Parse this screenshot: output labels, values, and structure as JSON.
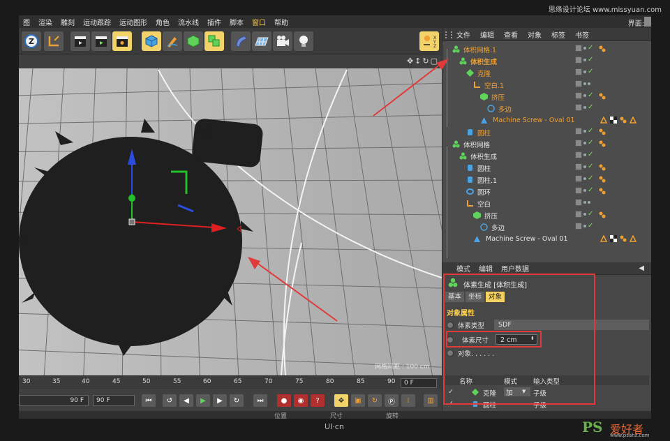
{
  "watermark_top": "思缘设计论坛 www.missyuan.com",
  "watermark_bottom": "UI·cn",
  "watermark_logo": {
    "ps": "PS",
    "cn": "爱好者",
    "url": "www.psahz.com"
  },
  "menubar": {
    "items": [
      "图",
      "渲染",
      "雕刻",
      "运动跟踪",
      "运动图形",
      "角色",
      "流水线",
      "插件",
      "脚本",
      "窗口",
      "帮助"
    ],
    "layout_label": "界面:"
  },
  "viewport": {
    "grid_spacing": "网格间距 : 100 cm"
  },
  "timeline": {
    "ticks": [
      "30",
      "35",
      "40",
      "45",
      "50",
      "55",
      "60",
      "65",
      "70",
      "75",
      "80",
      "85",
      "90"
    ],
    "current_frame": "0 F"
  },
  "playbar": {
    "start_field": "90 F",
    "end_field": "90 F"
  },
  "bottom_strip": {
    "labels": [
      "位置",
      "尺寸",
      "旋转"
    ]
  },
  "object_manager": {
    "menu": [
      "文件",
      "编辑",
      "查看",
      "对象",
      "标签",
      "书签"
    ],
    "rows": [
      {
        "name": "体积网格.1",
        "color": "orange"
      },
      {
        "name": "体积生成",
        "color": "orange"
      },
      {
        "name": "克隆",
        "color": "orange"
      },
      {
        "name": "空白.1",
        "color": "orange"
      },
      {
        "name": "挤压",
        "color": "orange"
      },
      {
        "name": "多边",
        "color": "orange"
      },
      {
        "name": "Machine Screw - Oval 01",
        "color": "orange"
      },
      {
        "name": "圆柱",
        "color": "orange"
      },
      {
        "name": "体积网格",
        "color": "white"
      },
      {
        "name": "体积生成",
        "color": "white"
      },
      {
        "name": "圆柱",
        "color": "white"
      },
      {
        "name": "圆柱.1",
        "color": "white"
      },
      {
        "name": "圆环",
        "color": "white"
      },
      {
        "name": "空白",
        "color": "white"
      },
      {
        "name": "挤压",
        "color": "white"
      },
      {
        "name": "多边",
        "color": "white"
      },
      {
        "name": "Machine Screw - Oval 01",
        "color": "white"
      }
    ]
  },
  "attribute_manager": {
    "menu": [
      "模式",
      "编辑",
      "用户数据"
    ],
    "title": "体素生成 [体积生成]",
    "tabs": [
      "基本",
      "坐标",
      "对象"
    ],
    "section": "对象属性",
    "voxel_type_label": "体素类型",
    "voxel_type_value": "SDF",
    "voxel_size_label": "体素尺寸",
    "voxel_size_value": "2 cm",
    "objects_label": "对象. . . . . .",
    "table_headers": [
      "名称",
      "模式",
      "输入类型"
    ],
    "table_rows": [
      {
        "name": "克隆",
        "mode": "加",
        "input": "子级"
      },
      {
        "name": "圆柱",
        "mode": "",
        "input": "子级"
      }
    ]
  },
  "colors": {
    "accent": "#f3d160",
    "highlight_box": "#e03a3a",
    "orange_text": "#f0a030"
  }
}
